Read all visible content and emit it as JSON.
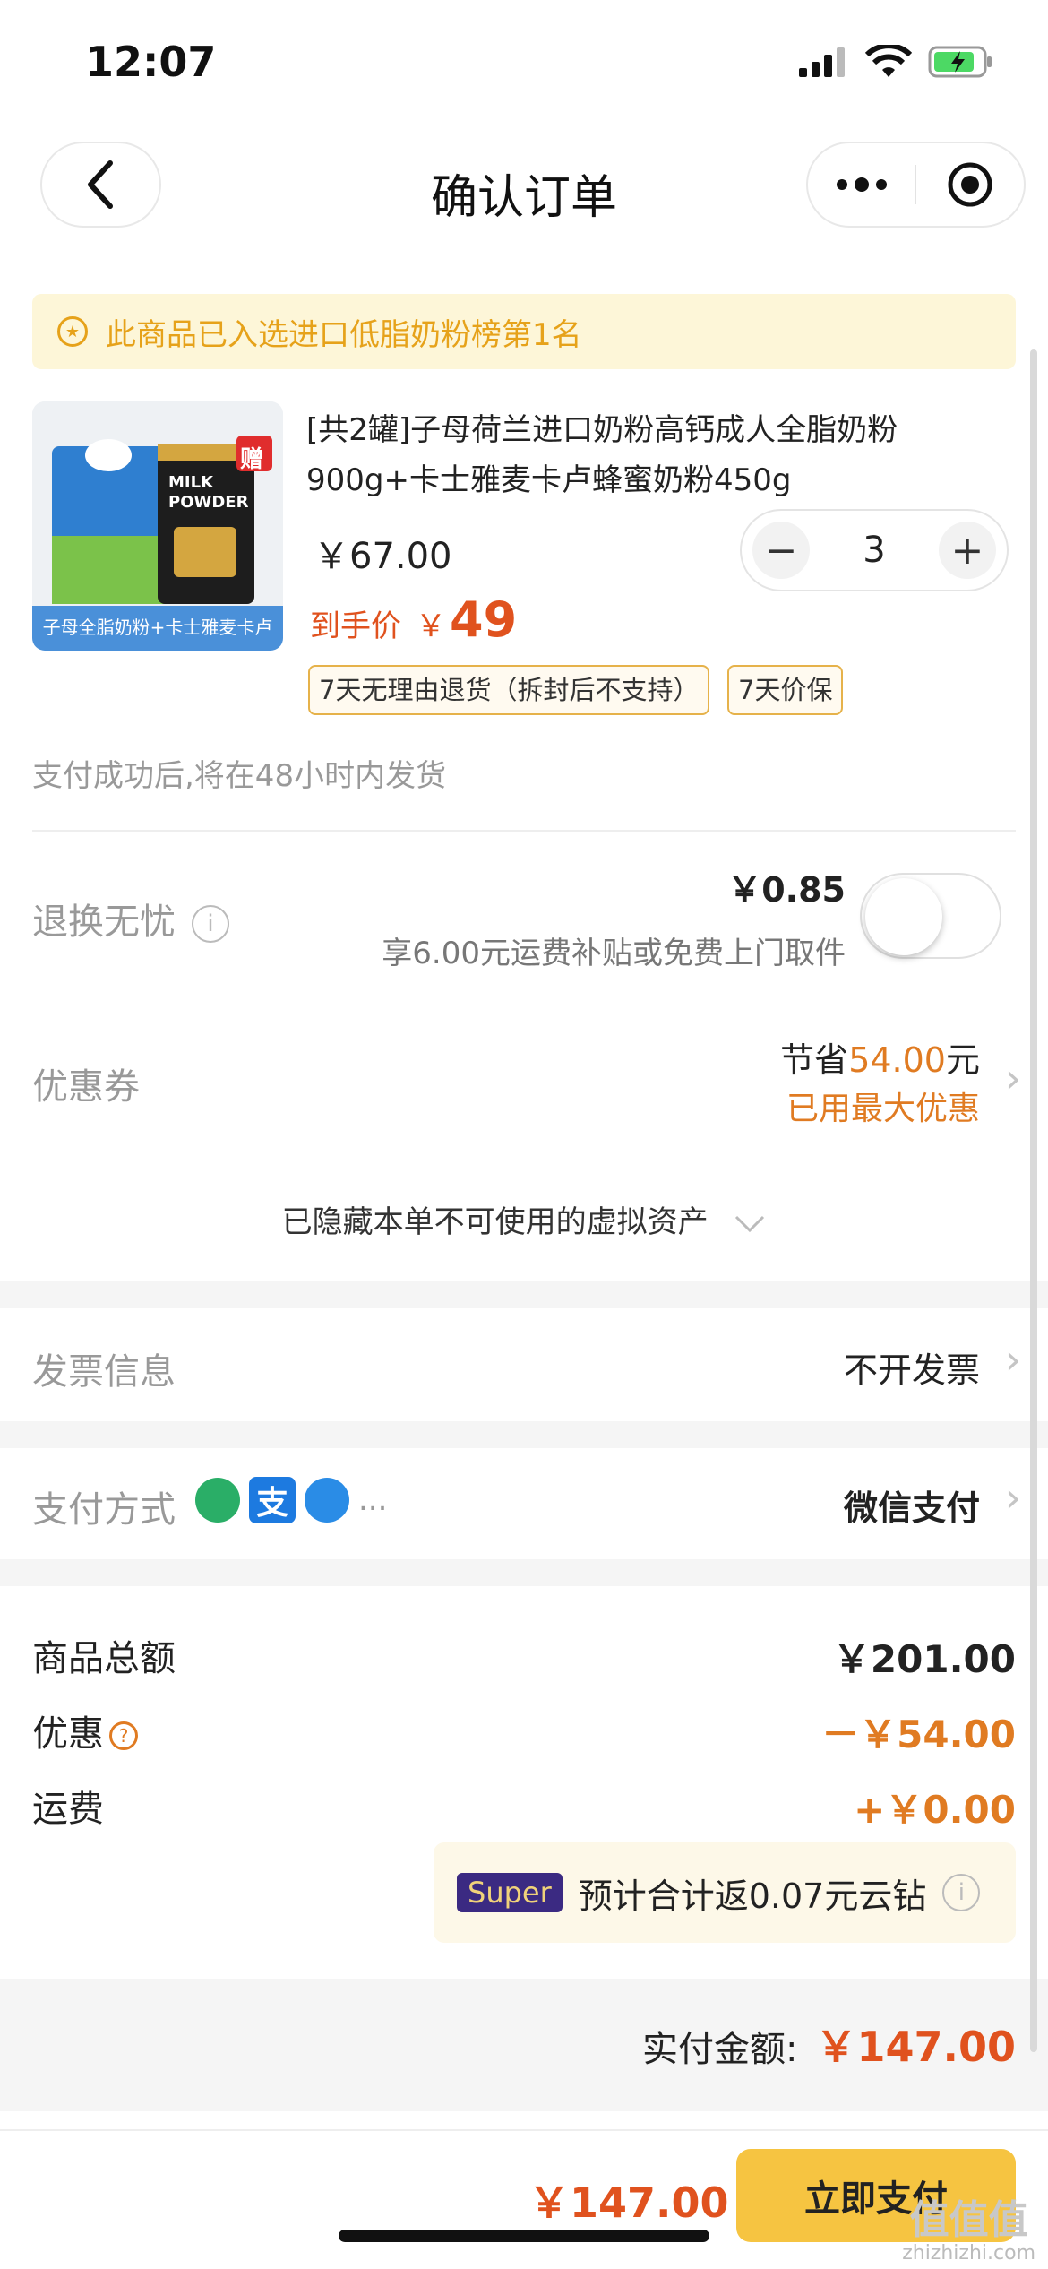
{
  "status_bar": {
    "time": "12:07"
  },
  "nav": {
    "title": "确认订单"
  },
  "banner": {
    "text": "此商品已入选进口低脂奶粉榜第1名"
  },
  "product": {
    "image_label": "子母全脂奶粉+卡士雅麦卡卢",
    "gift_badge": "赠",
    "milk_label": "MILK\nPOWDER",
    "title": "[共2罐]子母荷兰进口奶粉高钙成人全脂奶粉900g+卡士雅麦卡卢蜂蜜奶粉450g",
    "unit_price": "￥67.00",
    "quantity": "3",
    "minus": "−",
    "plus": "+",
    "hand_price_label": "到手价",
    "hand_price_currency": "￥",
    "hand_price_value": "49",
    "tags": [
      "7天无理由退货（拆封后不支持）",
      "7天价保"
    ]
  },
  "shipping_note": "支付成功后,将在48小时内发货",
  "return_worry": {
    "label": "退换无忧",
    "price": "￥0.85",
    "desc": "享6.00元运费补贴或免费上门取件",
    "enabled": false
  },
  "coupon": {
    "label": "优惠券",
    "save_prefix": "节省",
    "save_amount": "54.00",
    "save_suffix": "元",
    "best": "已用最大优惠"
  },
  "hidden_assets": "已隐藏本单不可使用的虚拟资产",
  "invoice": {
    "label": "发票信息",
    "value": "不开发票"
  },
  "payment": {
    "label": "支付方式",
    "more": "...",
    "value": "微信支付",
    "ali_glyph": "支"
  },
  "summary": {
    "goods_label": "商品总额",
    "goods_value": "￥201.00",
    "discount_label": "优惠",
    "discount_value": "－￥54.00",
    "freight_label": "运费",
    "freight_value": "+￥0.00"
  },
  "super": {
    "badge": "Super",
    "text": "预计合计返0.07元云钻"
  },
  "pay_total": {
    "label": "实付金额:",
    "value": "￥147.00"
  },
  "bottom": {
    "total": "￥147.00",
    "button": "立即支付"
  },
  "watermark": {
    "logo": "值值值",
    "site": "zhizhizhi.com"
  },
  "colors": {
    "accent_orange": "#e0521e",
    "button_yellow": "#f6c441",
    "banner_text": "#e6a21a"
  }
}
